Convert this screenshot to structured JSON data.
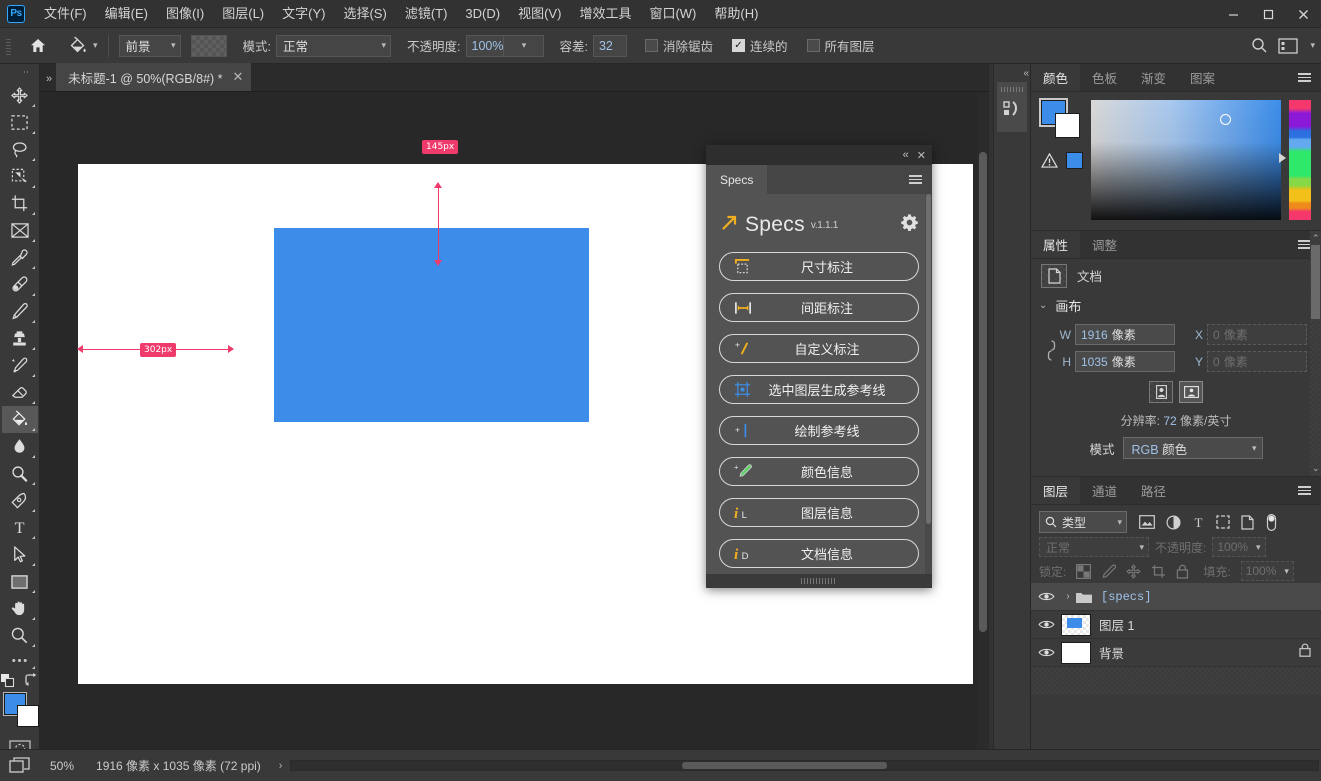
{
  "app": {
    "logo_text": "Ps",
    "menus": [
      "文件(F)",
      "编辑(E)",
      "图像(I)",
      "图层(L)",
      "文字(Y)",
      "选择(S)",
      "滤镜(T)",
      "3D(D)",
      "视图(V)",
      "增效工具",
      "窗口(W)",
      "帮助(H)"
    ],
    "window_buttons": {
      "minimize": "—",
      "maximize": "▢",
      "close": "✕"
    }
  },
  "options_bar": {
    "tool_preset_label": "前景",
    "mode_label": "模式:",
    "mode_value": "正常",
    "opacity_label": "不透明度:",
    "opacity_value": "100%",
    "tolerance_label": "容差:",
    "tolerance_value": "32",
    "antialias_label": "消除锯齿",
    "antialias_checked": false,
    "contiguous_label": "连续的",
    "contiguous_checked": true,
    "alllayers_label": "所有图层",
    "alllayers_checked": false
  },
  "toolbar": {
    "tools": [
      {
        "name": "move-tool",
        "active": false
      },
      {
        "name": "marquee-tool",
        "active": false
      },
      {
        "name": "lasso-tool",
        "active": false
      },
      {
        "name": "quick-selection-tool",
        "active": false
      },
      {
        "name": "crop-tool",
        "active": false
      },
      {
        "name": "frame-tool",
        "active": false
      },
      {
        "name": "eyedropper-tool",
        "active": false
      },
      {
        "name": "healing-brush-tool",
        "active": false
      },
      {
        "name": "brush-tool",
        "active": false
      },
      {
        "name": "clone-stamp-tool",
        "active": false
      },
      {
        "name": "history-brush-tool",
        "active": false
      },
      {
        "name": "eraser-tool",
        "active": false
      },
      {
        "name": "paint-bucket-tool",
        "active": true
      },
      {
        "name": "blur-tool",
        "active": false
      },
      {
        "name": "dodge-tool",
        "active": false
      },
      {
        "name": "pen-tool",
        "active": false
      },
      {
        "name": "type-tool",
        "active": false
      },
      {
        "name": "path-selection-tool",
        "active": false
      },
      {
        "name": "rectangle-tool",
        "active": false
      },
      {
        "name": "hand-tool",
        "active": false
      },
      {
        "name": "zoom-tool",
        "active": false
      },
      {
        "name": "more-tools",
        "active": false
      }
    ],
    "foreground_color": "#3C8DEA",
    "background_color": "#FFFFFF"
  },
  "document": {
    "tab_title": "未标题-1 @ 50%(RGB/8#) *",
    "close_glyph": "✕"
  },
  "canvas": {
    "rect_color": "#3C8DEA",
    "annotation_color": "#EE3B6C",
    "measurements": [
      {
        "name": "vertical-top-offset",
        "label": "145px"
      },
      {
        "name": "horizontal-left-offset",
        "label": "302px"
      }
    ]
  },
  "status_bar": {
    "zoom": "50%",
    "dimensions": "1916 像素 x 1035 像素 (72 ppi)",
    "arrow": "›"
  },
  "specs_panel": {
    "tab_label": "Specs",
    "title": "Specs",
    "version": "v.1.1.1",
    "collapse_glyph": "«",
    "close_glyph": "✕",
    "buttons": [
      {
        "icon": "size-annotation-icon",
        "label": "尺寸标注"
      },
      {
        "icon": "spacing-annotation-icon",
        "label": "间距标注"
      },
      {
        "icon": "custom-annotation-icon",
        "label": "自定义标注"
      },
      {
        "icon": "layer-guide-icon",
        "label": "选中图层生成参考线"
      },
      {
        "icon": "draw-guide-icon",
        "label": "绘制参考线"
      },
      {
        "icon": "color-info-icon",
        "label": "颜色信息"
      },
      {
        "icon": "layer-info-icon",
        "label": "图层信息"
      },
      {
        "icon": "document-info-icon",
        "label": "文档信息"
      }
    ]
  },
  "color_panel": {
    "tabs": [
      "颜色",
      "色板",
      "渐变",
      "图案"
    ],
    "active_tab": "颜色",
    "foreground": "#3C8DEA",
    "background": "#FFFFFF"
  },
  "properties_panel": {
    "tabs": [
      "属性",
      "调整"
    ],
    "active_tab": "属性",
    "doc_label": "文档",
    "section_title": "画布",
    "w_label": "W",
    "w_value": "1916",
    "w_unit": "像素",
    "h_label": "H",
    "h_value": "1035",
    "h_unit": "像素",
    "x_label": "X",
    "x_value": "0",
    "x_unit": "像素",
    "y_label": "Y",
    "y_value": "0",
    "y_unit": "像素",
    "resolution_text": "分辨率:",
    "resolution_value": "72",
    "resolution_unit": "像素/英寸",
    "mode_label": "模式",
    "mode_value_prefix": "RGB",
    "mode_value_suffix": "颜色"
  },
  "layers_panel": {
    "tabs": [
      "图层",
      "通道",
      "路径"
    ],
    "active_tab": "图层",
    "filter_label": "类型",
    "blend_mode": "正常",
    "opacity_label": "不透明度:",
    "opacity_value": "100%",
    "lock_label": "锁定:",
    "fill_label": "填充:",
    "fill_value": "100%",
    "rows": [
      {
        "name": "[specs]",
        "type": "group",
        "visible": true,
        "selected": true,
        "locked": false
      },
      {
        "name": "图层 1",
        "type": "pixel",
        "visible": true,
        "selected": false,
        "locked": false,
        "thumb_color": "#3C8DEA"
      },
      {
        "name": "背景",
        "type": "background",
        "visible": true,
        "selected": false,
        "locked": true,
        "thumb_color": "#FFFFFF"
      }
    ],
    "footer_icons": [
      "link-icon",
      "fx-icon",
      "mask-icon",
      "adjustment-icon",
      "group-icon",
      "new-layer-icon",
      "delete-icon"
    ]
  }
}
